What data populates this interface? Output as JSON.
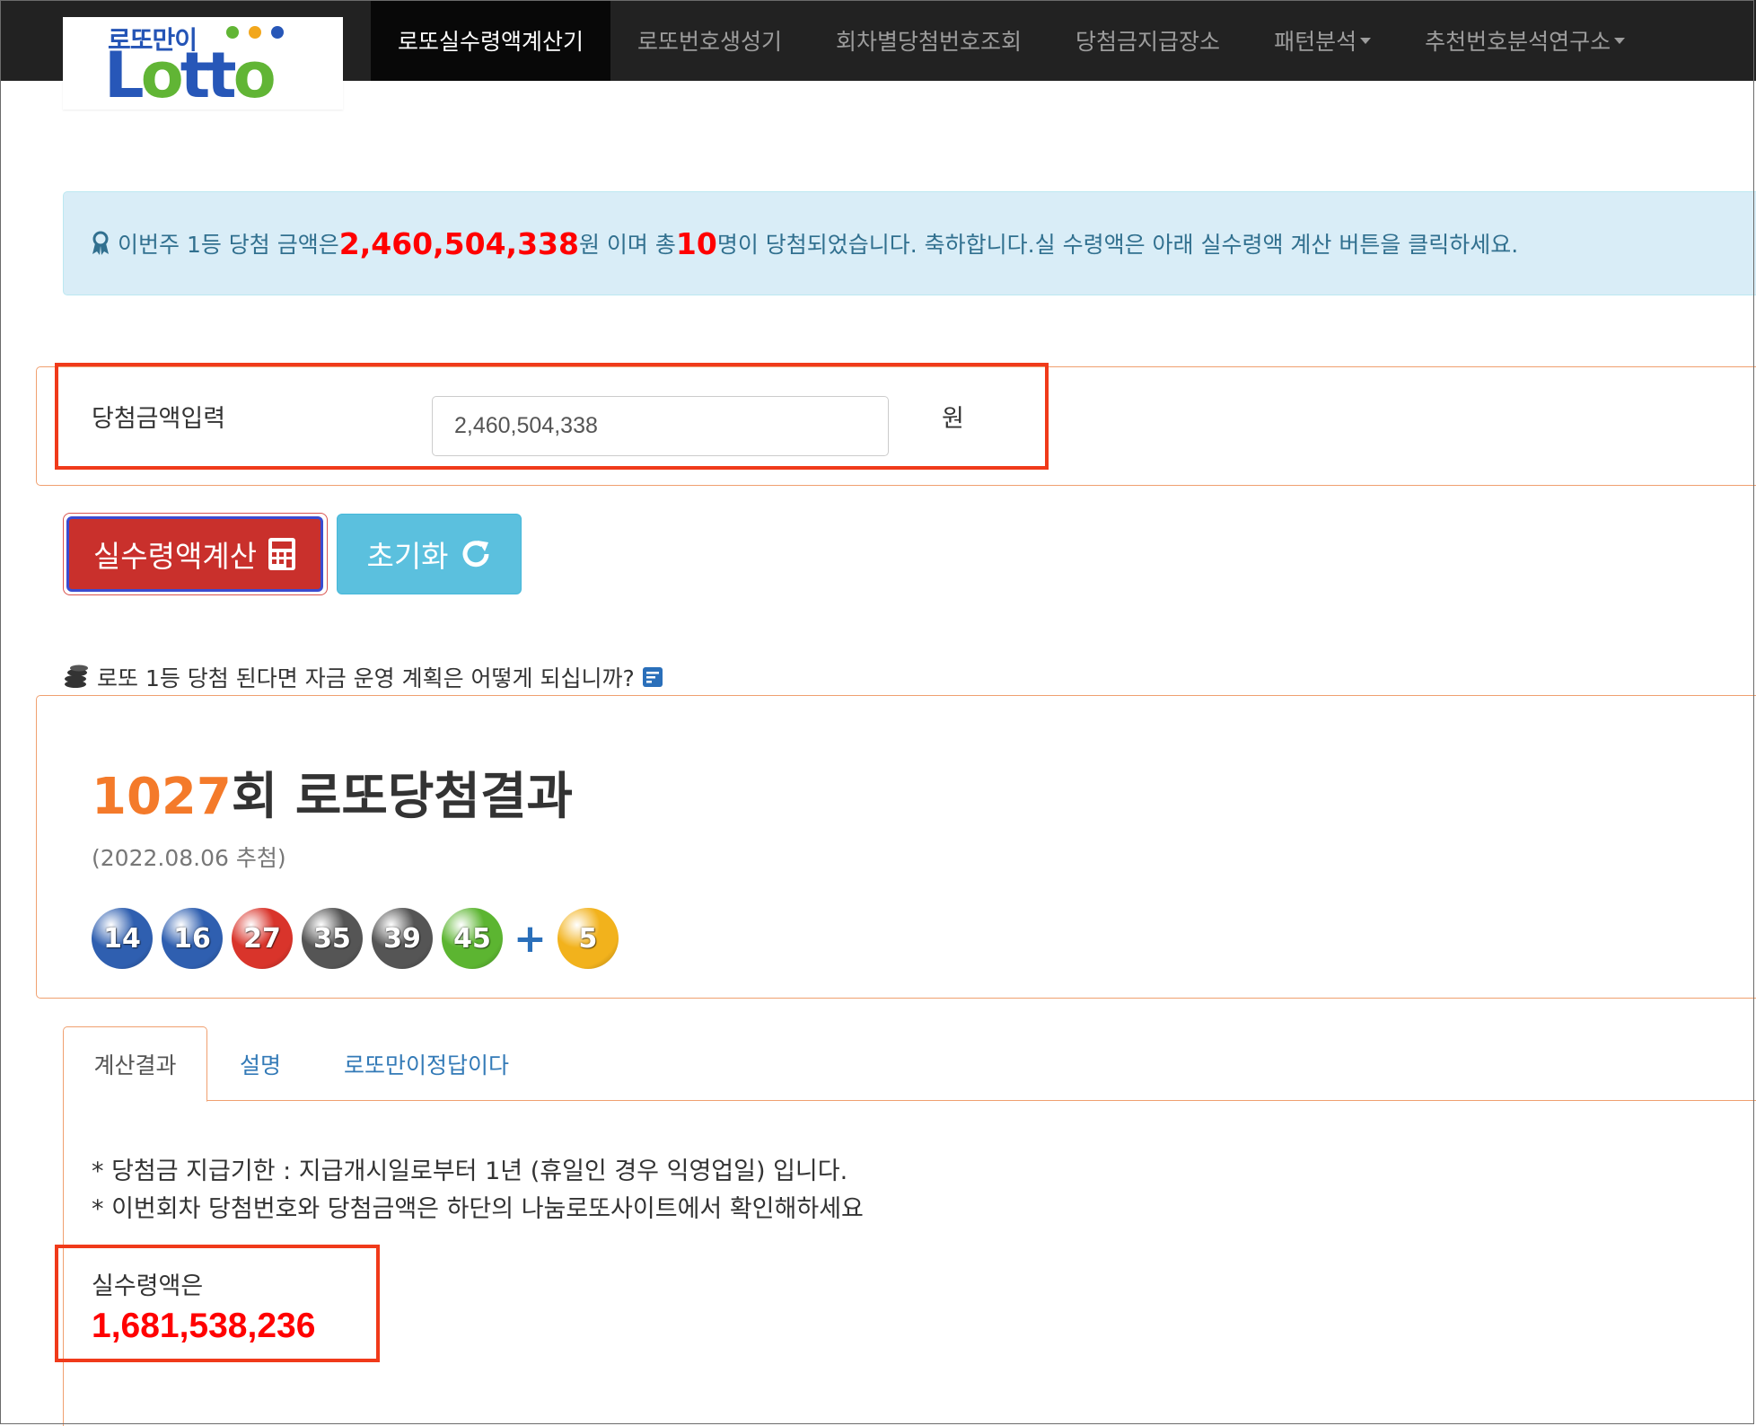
{
  "nav": {
    "logo_small": "로또만이",
    "logo_big": "Lotto",
    "items": [
      {
        "label": "로또실수령액계산기",
        "active": true
      },
      {
        "label": "로또번호생성기"
      },
      {
        "label": "회차별당첨번호조회"
      },
      {
        "label": "당첨금지급장소"
      },
      {
        "label": "패턴분석",
        "dropdown": true
      },
      {
        "label": "추천번호분석연구소",
        "dropdown": true
      }
    ]
  },
  "alert": {
    "pre": "이번주 1등 당첨 금액은 ",
    "amount": "2,460,504,338",
    "mid": "원 이며 총 ",
    "winners": "10",
    "post": "명이 당첨되었습니다. 축하합니다.실 수령액은 아래 실수령액 계산 버튼을 클릭하세요."
  },
  "form": {
    "label": "당첨금액입력",
    "value": "2,460,504,338",
    "unit": "원"
  },
  "buttons": {
    "calc": "실수령액계산",
    "reset": "초기화"
  },
  "question": "로또 1등 당첨 된다면 자금 운영 계획은 어떻게 되십니까?",
  "result": {
    "round": "1027",
    "title_suffix": "회 로또당첨결과",
    "date": "(2022.08.06 추첨)",
    "balls": [
      {
        "n": "14",
        "color": "#2f5fb0"
      },
      {
        "n": "16",
        "color": "#2f5fb0"
      },
      {
        "n": "27",
        "color": "#d9342b"
      },
      {
        "n": "35",
        "color": "#555555"
      },
      {
        "n": "39",
        "color": "#555555"
      },
      {
        "n": "45",
        "color": "#5cb531"
      }
    ],
    "plus": "+",
    "bonus": {
      "n": "5",
      "color": "#f2b21c"
    }
  },
  "tabs": [
    {
      "label": "계산결과",
      "active": true
    },
    {
      "label": "설명"
    },
    {
      "label": "로또만이정답이다"
    }
  ],
  "notes": [
    "* 당첨금 지급기한 : 지급개시일로부터 1년 (휴일인 경우 익영업일) 입니다.",
    "* 이번회차 당첨번호와 당첨금액은 하단의 나눔로또사이트에서 확인해하세요"
  ],
  "net": {
    "label": "실수령액은",
    "value": "1,681,538,236"
  }
}
